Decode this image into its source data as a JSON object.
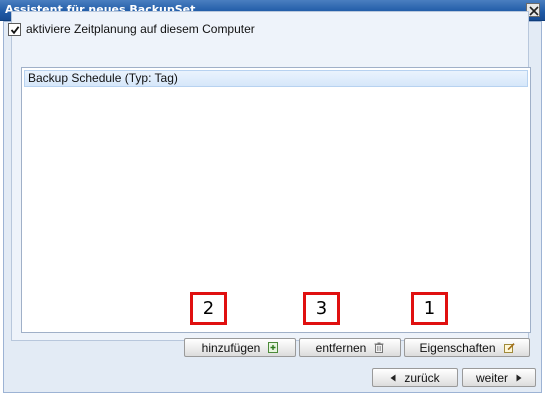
{
  "window": {
    "title": "Assistent für neues BackupSet",
    "close_label": "close"
  },
  "schedule": {
    "enable_label": "aktiviere Zeitplanung auf diesem Computer",
    "enabled": true,
    "items": [
      {
        "label": "Backup Schedule (Typ: Tag)",
        "selected": true
      }
    ]
  },
  "list_buttons": {
    "add_label": "hinzufügen",
    "add_icon": "add-document-icon",
    "remove_label": "entfernen",
    "remove_icon": "trash-icon",
    "properties_label": "Eigenschaften",
    "properties_icon": "edit-pencil-icon"
  },
  "annotations": {
    "add_marker": "2",
    "remove_marker": "3",
    "properties_marker": "1",
    "color": "#e01010"
  },
  "nav_buttons": {
    "back_label": "zurück",
    "back_icon": "arrow-left-icon",
    "next_label": "weiter",
    "next_icon": "arrow-right-icon"
  },
  "colors": {
    "titlebar": "#1f5aa6",
    "client_background": "#e3ebf5",
    "selection": "#d6e7fa"
  }
}
